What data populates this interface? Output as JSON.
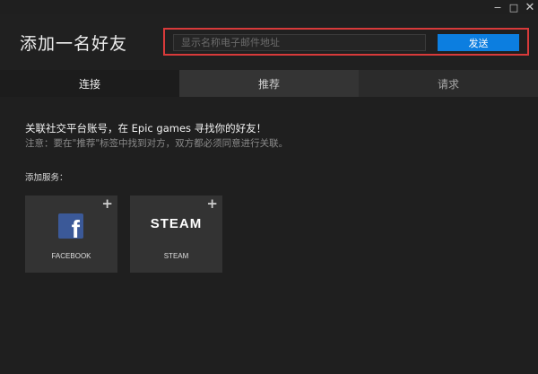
{
  "window": {
    "minimize_glyph": "−",
    "maximize_glyph": "□",
    "close_glyph": "✕"
  },
  "header": {
    "title": "添加一名好友",
    "search": {
      "placeholder": "显示名称电子邮件地址",
      "value": ""
    },
    "send_label": "发送",
    "highlight_color": "#d83a3a",
    "accent_color": "#0c7ee0"
  },
  "tabs": [
    {
      "label": "连接",
      "active": true
    },
    {
      "label": "推荐",
      "active": false
    },
    {
      "label": "请求",
      "active": false
    }
  ],
  "main": {
    "message": "关联社交平台账号，在 Epic games 寻找你的好友！",
    "note": "注意：要在\"推荐\"标签中找到对方，双方都必须同意进行关联。",
    "services_label": "添加服务：",
    "services": [
      {
        "name": "FACEBOOK",
        "logo_text": "f",
        "icon": "facebook-icon",
        "add_glyph": "+"
      },
      {
        "name": "STEAM",
        "logo_text": "STEAM",
        "icon": "steam-logo",
        "add_glyph": "+"
      }
    ]
  }
}
